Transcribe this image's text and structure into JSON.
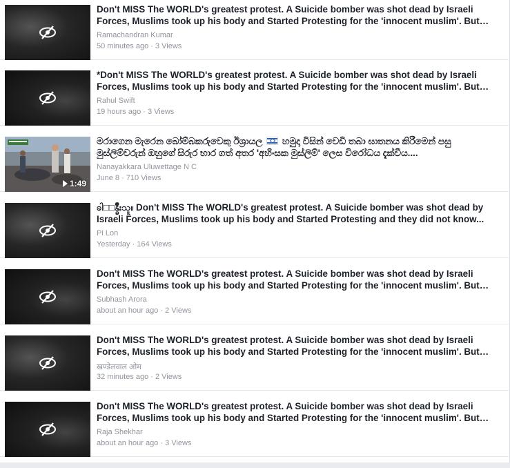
{
  "items": [
    {
      "title": "Don't MISS The WORLD's greatest protest. A Suicide bomber was shot dead by Israeli Forces, Muslims took up his body and Started Protesting for the 'innocent muslim'. But the...",
      "author": "Ramachandran Kumar",
      "meta": "50 minutes ago · 3 Views",
      "thumb_icon": "hidden-eye-icon"
    },
    {
      "title": "*Don't MISS The WORLD's greatest protest. A Suicide bomber was shot dead by Israeli Forces, Muslims took up his body and Started Protesting for the 'innocent muslim'. But the...",
      "author": "Rahul Swift",
      "meta": "19 hours ago · 3 Views",
      "thumb_icon": "hidden-eye-icon"
    },
    {
      "title_before_flag": "මරාගෙන මැරෙන බෝම්බකරුවෙකු ඊශ්‍රායල",
      "flag_icon": "israel-flag-icon",
      "title_after_flag": "හමුදා විසින් වෙඩි තබා ඝාතනය කිරීමෙන් පසු මුස්ලිම්වරුන් ඔහුගේ සිරුර භාර ගත් අතර 'අහිංසක මුස්ලිම්' ලෙස විරෝධය දැක්වීය....",
      "author": "Nanayakkara Uluwettage N C",
      "meta": "June 8 · 710 Views",
      "duration": "1:49",
      "thumb_icon": "play-icon"
    },
    {
      "title": "ခါ□□န္ခ်ိဳးသူ။ Don't MISS The WORLD's greatest protest. A Suicide bomber was shot dead by Israeli Forces, Muslims took up his body and Started Protesting and they did not know...",
      "author": "Pi Lon",
      "meta": "Yesterday · 164 Views",
      "thumb_icon": "hidden-eye-icon"
    },
    {
      "title": "Don't MISS The WORLD's greatest protest. A Suicide bomber was shot dead by Israeli Forces, Muslims took up his body and Started Protesting for the 'innocent muslim'. But the...",
      "author": "Subhash Arora",
      "meta": "about an hour ago · 2 Views",
      "thumb_icon": "hidden-eye-icon"
    },
    {
      "title": "Don't MISS The WORLD's greatest protest. A Suicide bomber was shot dead by Israeli Forces, Muslims took up his body and Started Protesting for the 'innocent muslim'. But the...",
      "author": "खण्डेलवाल ओम",
      "meta": "32 minutes ago · 2 Views",
      "thumb_icon": "hidden-eye-icon"
    },
    {
      "title": "Don't MISS The WORLD's greatest protest. A Suicide bomber was shot dead by Israeli Forces, Muslims took up his body and Started Protesting for the 'innocent muslim'. But the...",
      "author": "Raja Shekhar",
      "meta": "about an hour ago · 3 Views",
      "thumb_icon": "hidden-eye-icon"
    }
  ],
  "colors": {
    "title": "#1d2129",
    "secondary": "#90949c",
    "background": "#e9ebee",
    "card": "#ffffff"
  }
}
